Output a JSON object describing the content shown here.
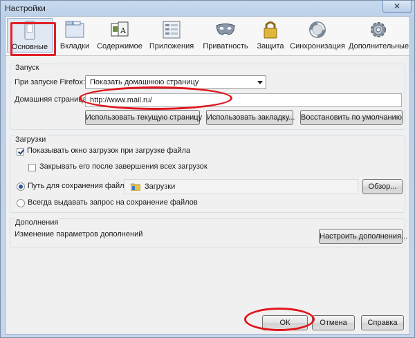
{
  "window": {
    "title": "Настройки",
    "close_label": "✕"
  },
  "tabs": [
    {
      "label": "Основные"
    },
    {
      "label": "Вкладки"
    },
    {
      "label": "Содержимое"
    },
    {
      "label": "Приложения"
    },
    {
      "label": "Приватность"
    },
    {
      "label": "Защита"
    },
    {
      "label": "Синхронизация"
    },
    {
      "label": "Дополнительные"
    }
  ],
  "startup": {
    "group_title": "Запуск",
    "when_starts_label": "При запуске Firefox:",
    "when_starts_value": "Показать домашнюю страницу",
    "homepage_label": "Домашняя страница:",
    "homepage_value": "http://www.mail.ru/",
    "use_current_button": "Использовать текущую страницу",
    "use_bookmark_button": "Использовать закладку...",
    "restore_default_button": "Восстановить по умолчанию"
  },
  "downloads": {
    "group_title": "Загрузки",
    "show_window_label": "Показывать окно загрузок при загрузке файла",
    "show_window_checked": true,
    "close_when_done_label": "Закрывать его после завершения всех загрузок",
    "close_when_done_checked": false,
    "save_path_label": "Путь для сохранения файлов",
    "save_path_value": "Загрузки",
    "browse_button": "Обзор...",
    "always_ask_label": "Всегда выдавать запрос на сохранение файлов",
    "selected_option": "save_path"
  },
  "addons": {
    "group_title": "Дополнения",
    "description": "Изменение параметров дополнений",
    "configure_button": "Настроить дополнения..."
  },
  "footer": {
    "ok_button": "ОК",
    "cancel_button": "Отмена",
    "help_button": "Справка"
  },
  "colors": {
    "annotation_red": "#e0161d",
    "accent": "#2a5b9a"
  }
}
